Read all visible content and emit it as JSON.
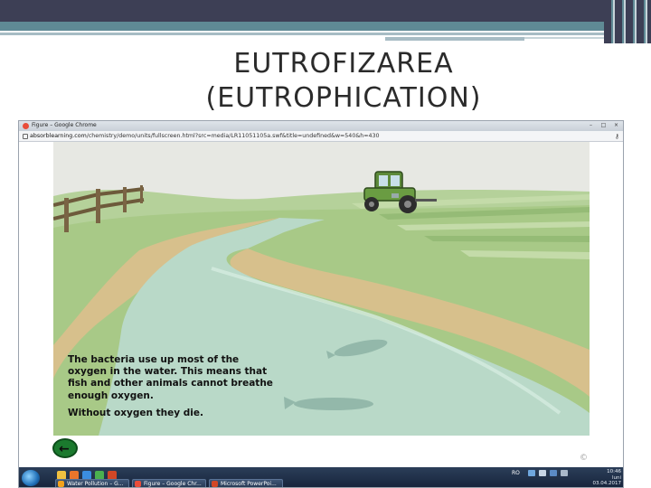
{
  "slide": {
    "title_line1": "EUTROFIZAREA",
    "title_line2": "(EUTROPHICATION)"
  },
  "browser": {
    "window_title": "Figure – Google Chrome",
    "url_domain": "absorblearning.com",
    "url_path": "/chemistry/demo/units/fullscreen.html?src=media/LR11051105a.swf&title=undefined&w=540&h=430",
    "controls": {
      "minimize": "–",
      "maximize": "□",
      "close": "×"
    },
    "key_icon": "key-icon",
    "lock_icon": "page-icon"
  },
  "content": {
    "caption_para1": "The bacteria use up most of the oxygen in the water. This means that fish and other animals cannot breathe enough oxygen.",
    "caption_para2": "Without oxygen they die.",
    "back_icon": "arrow-left-icon",
    "back_arrow_glyph": "←",
    "copyright": "©"
  },
  "taskbar": {
    "start_icon": "windows-start-icon",
    "tasks": [
      {
        "label": "Water Pollution – G...",
        "icon_color": "#f3a21c"
      },
      {
        "label": "Figure – Google Chr...",
        "icon_color": "#e94d3a"
      },
      {
        "label": "Microsoft PowerPoi...",
        "icon_color": "#d24726"
      }
    ],
    "language": "RO",
    "clock_time": "10:46",
    "clock_day": "luni",
    "clock_date": "03.04.2017"
  },
  "colors": {
    "banner_dark": "#3d3f55",
    "banner_teal": "#5f8a95",
    "grass": "#a8c987",
    "river": "#b9d9c8",
    "sky": "#e7e8e3",
    "back_button": "#1b7a2e"
  }
}
